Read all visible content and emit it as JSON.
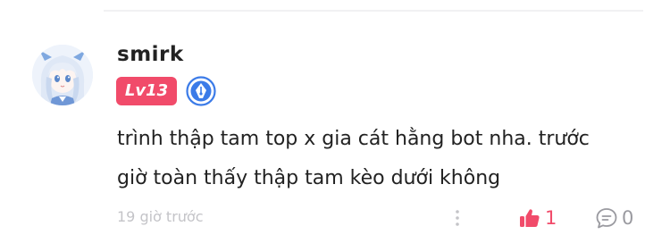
{
  "comment": {
    "username": "smirk",
    "level": "Lv13",
    "text_lines": [
      "trình thập tam top x gia cát hằng bot nha. trước",
      "giờ toàn thấy thập tam kèo dưới không"
    ],
    "timestamp": "19 giờ trước",
    "like_count": "1",
    "reply_count": "0",
    "icons": {
      "avatar": "anime-avatar",
      "verified": "verified-pen-badge-icon",
      "more": "more-vertical-icon",
      "like": "thumbs-up-icon",
      "reply": "comment-bubble-icon"
    }
  },
  "colors": {
    "level_badge": "#f14b6a",
    "like_active": "#f14b6a",
    "verified_blue": "#3b7be8",
    "muted": "#c4c4c8"
  }
}
